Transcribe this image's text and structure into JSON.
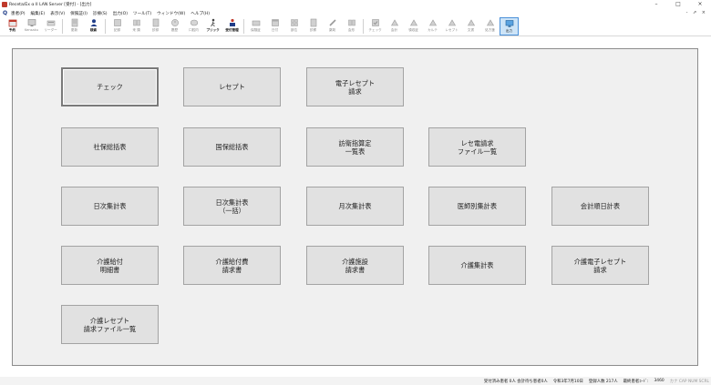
{
  "window": {
    "title": "Receta/Ex α II LAN Server [受付] - [出力]",
    "controls": [
      "–",
      "□",
      "×"
    ]
  },
  "menu": {
    "items": [
      "患者(P)",
      "編集(E)",
      "表示(V)",
      "保険証(I)",
      "診療(S)",
      "出力(O)",
      "ツール(T)",
      "ウィンドウ(W)",
      "ヘルプ(H)"
    ],
    "right": "- ⇗ ×"
  },
  "toolbar": {
    "items": [
      {
        "label": "予約",
        "icon": "calendar-icon"
      },
      {
        "label": "Kensaku",
        "icon": "monitor-icon"
      },
      {
        "label": "リーダー",
        "icon": "card-reader-icon"
      },
      {
        "label": "更新",
        "icon": "refresh-icon"
      },
      {
        "label": "検索",
        "icon": "search-person-icon"
      },
      {
        "label": "記録",
        "icon": "record-icon"
      },
      {
        "label": "来 頭",
        "icon": "arrival-icon"
      },
      {
        "label": "診録",
        "icon": "chart-icon"
      },
      {
        "label": "履歴",
        "icon": "history-icon"
      },
      {
        "label": "口腔内",
        "icon": "mouth-icon"
      },
      {
        "label": "プリック",
        "icon": "walking-icon"
      },
      {
        "label": "受付管理",
        "icon": "reception-icon"
      },
      {
        "label": "保険証",
        "icon": "insurance-icon"
      },
      {
        "label": "日付",
        "icon": "date-icon"
      },
      {
        "label": "部位",
        "icon": "region-icon"
      },
      {
        "label": "診察",
        "icon": "exam-icon"
      },
      {
        "label": "薬剤",
        "icon": "medicine-icon"
      },
      {
        "label": "会形",
        "icon": "form-icon"
      },
      {
        "label": "チェック",
        "icon": "check-icon"
      },
      {
        "label": "会計",
        "icon": "billing-icon"
      },
      {
        "label": "領収証",
        "icon": "receipt-icon"
      },
      {
        "label": "カルテ",
        "icon": "karte-icon"
      },
      {
        "label": "レセプト",
        "icon": "rezept-icon"
      },
      {
        "label": "文書",
        "icon": "document-icon"
      },
      {
        "label": "処方箋",
        "icon": "prescription-icon"
      },
      {
        "label": "出力",
        "icon": "output-icon"
      }
    ]
  },
  "panel": {
    "buttons": [
      "チェック",
      "レセプト",
      "電子レセプト\n請求",
      "社保総括表",
      "国保総括表",
      "訪衛指算定\n一覧表",
      "レセ電請求\nファイル一覧",
      "日次集計表",
      "日次集計表\n（一括）",
      "月次集計表",
      "医師別集計表",
      "会計順日計表",
      "介護給付\n明細書",
      "介護給付費\n請求書",
      "介護施設\n請求書",
      "介護集計表",
      "介護電子レセプト\n請求",
      "介護レセプト\n請求ファイル一覧"
    ]
  },
  "status": {
    "items": [
      "受付済み患者 0人 会計待ち患者0人",
      "令和3年7月10日",
      "登録人数 217人",
      "最終患者ｺｰﾄﾞ:",
      "3460"
    ],
    "keys": "カナ CAP NUM SCRL"
  }
}
